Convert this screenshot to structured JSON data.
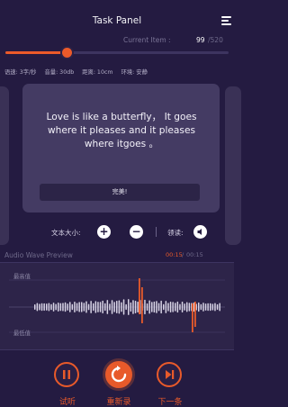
{
  "header": {
    "title": "Task Panel"
  },
  "progress": {
    "label": "Current Item :",
    "current": "99",
    "total": "/520",
    "fraction": 0.19
  },
  "settings": [
    "语速: 3字/秒",
    "音量: 30db",
    "距离: 10cm",
    "环境: 安静"
  ],
  "card": {
    "text": "Love is like a butterfly， It goes where it pleases and it pleases where itgoes 。",
    "button": "完美!"
  },
  "controls": {
    "text_size_label": "文本大小:",
    "plus": "+",
    "minus": "−",
    "read_label": "领读:"
  },
  "wave": {
    "title": "Audio Wave Preview",
    "time_current": "00:15",
    "time_sep": "/",
    "time_total": "00:15",
    "max_label": "最高值",
    "min_label": "最低值"
  },
  "bottom": {
    "pause_label": "试听",
    "record_label": "重新录",
    "next_label": "下一条"
  },
  "colors": {
    "accent": "#e85a2a",
    "background": "#241b41",
    "card": "#443b63"
  }
}
